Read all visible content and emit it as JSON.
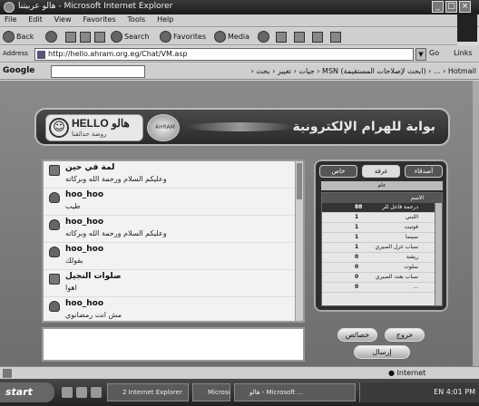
{
  "window": {
    "title": "هالو عربيتنا - Microsoft Internet Explorer",
    "controls": [
      "_",
      "□",
      "×"
    ]
  },
  "menu": [
    "File",
    "Edit",
    "View",
    "Favorites",
    "Tools",
    "Help"
  ],
  "toolbar": {
    "back": "Back",
    "search": "Search",
    "favorites": "Favorites",
    "media": "Media"
  },
  "address": {
    "label": "Address",
    "url": "http://hello.ahram.org.eg/Chat/VM.asp",
    "go": "Go",
    "links": "Links"
  },
  "googlebar": {
    "brand": "Google",
    "tools": "Hotmail ‹ ... ‹ (ابحث لإصلاحات المستقيمة) MSN ‹ جيات ‹ تغيير ‹ بحث ‹"
  },
  "header": {
    "logo_text": "HELLO هالو",
    "logo_sub": "روضة حدائقنا",
    "emblem": "AHRAM",
    "title": "بوابة للهرام الإلكترونية"
  },
  "chat": {
    "messages": [
      {
        "user": "لمة في حين",
        "text": "وعليكم السلام ورحمة الله وبركاته",
        "avatar": "square"
      },
      {
        "user": "hoo_hoo",
        "text": "طيب",
        "avatar": "person"
      },
      {
        "user": "hoo_hoo",
        "text": "وعليكم السلام ورحمة الله وبركاته",
        "avatar": "person"
      },
      {
        "user": "hoo_hoo",
        "text": "بقولك",
        "avatar": "person"
      },
      {
        "user": "صلوات النجيل",
        "text": "اهوا",
        "avatar": "square"
      },
      {
        "user": "hoo_hoo",
        "text": "مش انت رمضانوي",
        "avatar": "person"
      }
    ]
  },
  "side": {
    "tabs": [
      "أصدقاء",
      "غرفة",
      "خاص"
    ],
    "active_tab": 1,
    "room": "عام",
    "list_header": "الاسم",
    "users": [
      {
        "name": "الاسم",
        "count": ""
      },
      {
        "name": "درجمة فاعل للر",
        "count": "88"
      },
      {
        "name": "اللبني",
        "count": "1"
      },
      {
        "name": "فوتيت",
        "count": "1"
      },
      {
        "name": "سينما",
        "count": "1"
      },
      {
        "name": "سباب غرل الصيري",
        "count": "1"
      },
      {
        "name": "ريشة",
        "count": "0"
      },
      {
        "name": "سلوت",
        "count": "0"
      },
      {
        "name": "سباب بعث الصيري",
        "count": "0"
      },
      {
        "name": "...",
        "count": "0"
      }
    ],
    "btn_exit": "خروج",
    "btn_props": "خصائص",
    "btn_send": "إرسال"
  },
  "status": {
    "zone": "Internet"
  },
  "taskbar": {
    "start": "start",
    "tasks": [
      "2 Internet Explorer",
      "Microsoft Word",
      "هالو - Microsoft ..."
    ],
    "clock": "EN 4:01 PM"
  }
}
